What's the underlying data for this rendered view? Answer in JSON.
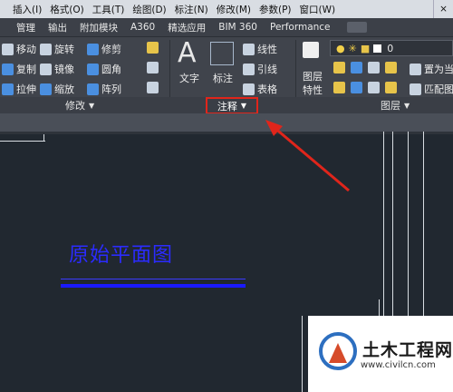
{
  "menu": {
    "items": [
      "插入(I)",
      "格式(O)",
      "工具(T)",
      "绘图(D)",
      "标注(N)",
      "修改(M)",
      "参数(P)",
      "窗口(W)"
    ],
    "close_symbol": "×"
  },
  "ribbon_tabs": [
    "管理",
    "输出",
    "附加模块",
    "A360",
    "精选应用",
    "BIM 360",
    "Performance"
  ],
  "ribbon": {
    "modify_panel": {
      "title": "修改",
      "tools": [
        "移动",
        "旋转",
        "修剪",
        "复制",
        "镜像",
        "圆角",
        "拉伸",
        "缩放",
        "阵列"
      ]
    },
    "annotation_panel": {
      "title": "注释",
      "text_label": "文字",
      "dim_label": "标注",
      "tools": [
        "线性",
        "引线",
        "表格"
      ]
    },
    "layers_panel": {
      "title": "图层",
      "big_label_1": "图层",
      "big_label_2": "特性",
      "layer_value": "0",
      "tools": [
        "置为当",
        "匹配图"
      ]
    }
  },
  "drawing": {
    "plan_title": "原始平面图"
  },
  "watermark": {
    "title": "土木工程网",
    "url": "www.civilcn.com"
  },
  "colors": {
    "highlight": "#e0251b",
    "plan_blue": "#1a1aff",
    "canvas": "#212830"
  }
}
